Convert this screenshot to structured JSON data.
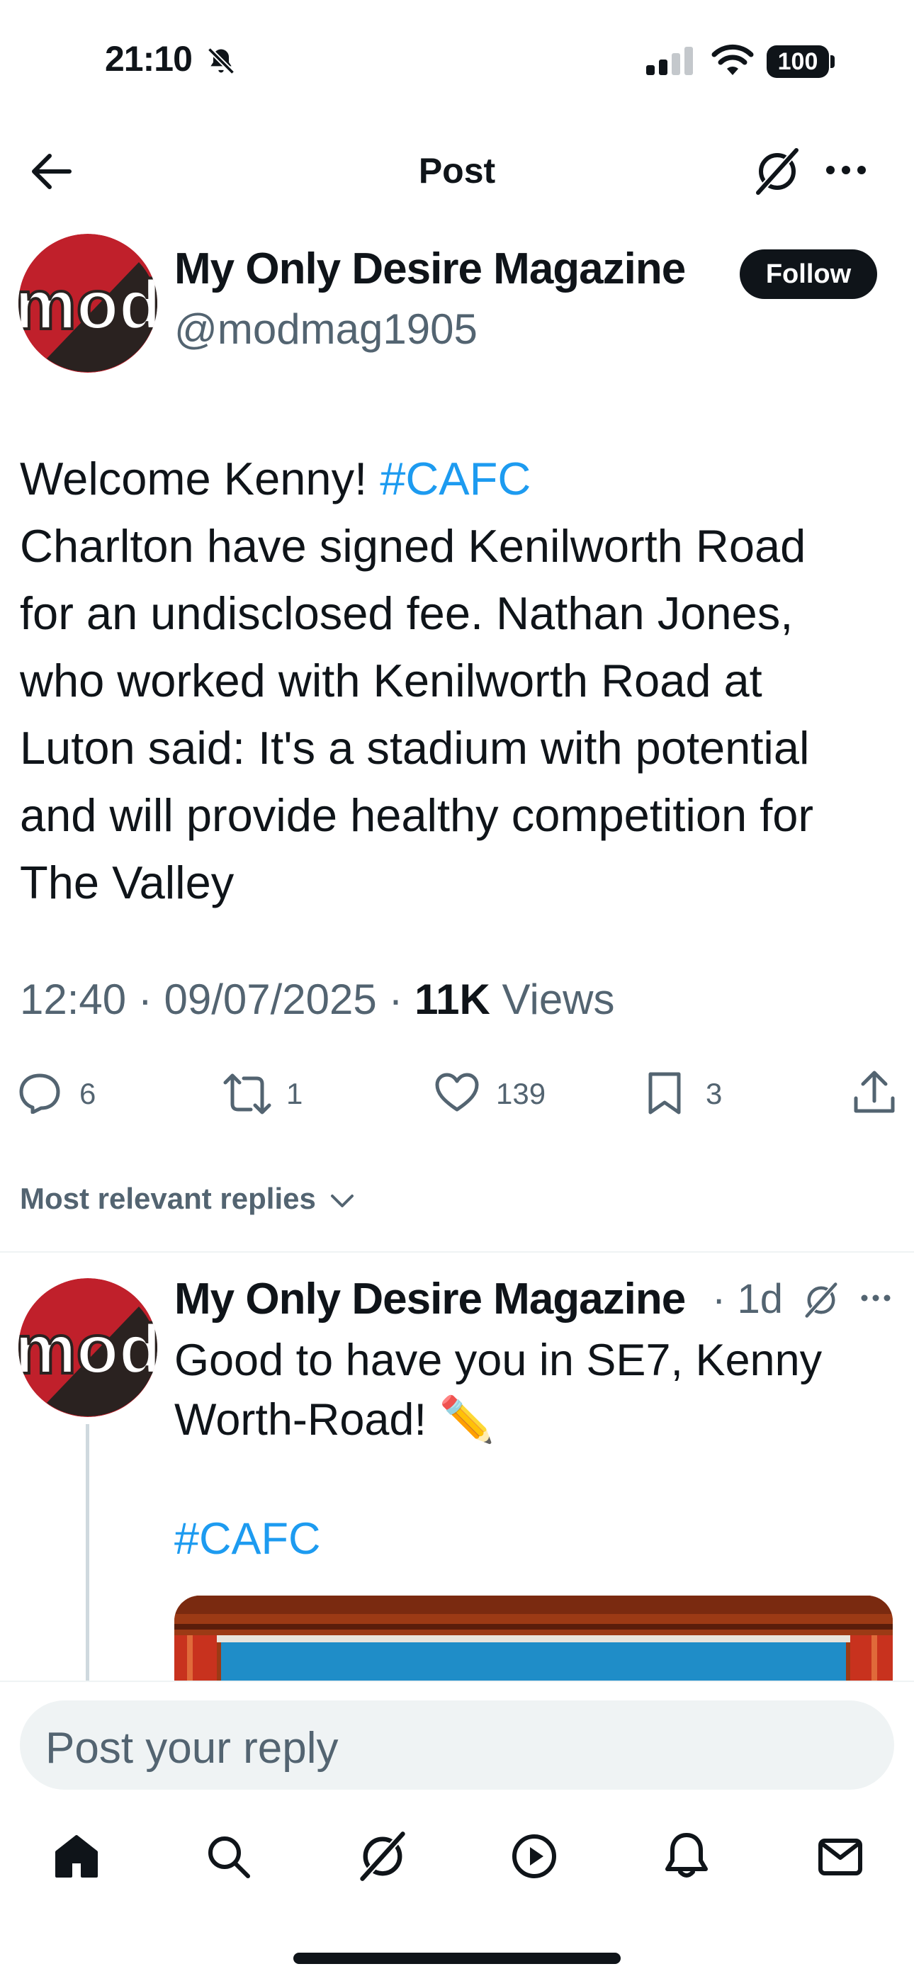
{
  "status_bar": {
    "time": "21:10",
    "battery": "100"
  },
  "header": {
    "title": "Post"
  },
  "tweet": {
    "author_name": "My Only Desire Magazine",
    "author_handle": "@modmag1905",
    "avatar_text": "mod",
    "follow_label": "Follow",
    "text_lines": [
      "Welcome Kenny! ",
      "Charlton have signed Kenilworth Road",
      "for an undisclosed fee. Nathan Jones,",
      "who worked with Kenilworth Road at",
      "Luton said: It's a stadium with potential",
      "and will provide healthy competition for",
      "The Valley"
    ],
    "hashtag": "#CAFC",
    "time": "12:40",
    "date": "09/07/2025",
    "views_count": "11K",
    "views_label": "Views",
    "actions": {
      "replies": "6",
      "reposts": "1",
      "likes": "139",
      "bookmarks": "3"
    }
  },
  "replies_sort": {
    "label": "Most relevant replies"
  },
  "reply": {
    "author_name": "My Only Desire Magazine",
    "age": "1d",
    "avatar_text": "mod",
    "text_lines": [
      "Good to have you in SE7, Kenny",
      "Worth-Road! ✏️"
    ],
    "hashtag": "#CAFC"
  },
  "composer": {
    "placeholder": "Post your reply"
  },
  "colors": {
    "accent": "#1d9bf0",
    "text": "#0f1419",
    "secondary": "#536471",
    "avatar_red": "#c0202b",
    "avatar_dark": "#2a2220"
  }
}
